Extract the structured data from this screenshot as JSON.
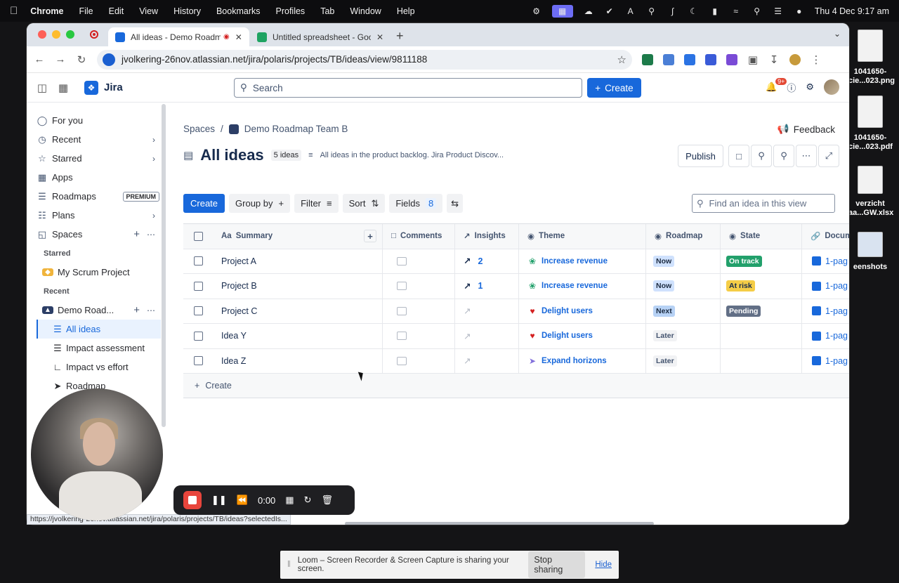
{
  "menubar": {
    "items": [
      "Chrome",
      "File",
      "Edit",
      "View",
      "History",
      "Bookmarks",
      "Profiles",
      "Tab",
      "Window",
      "Help"
    ],
    "datetime": "Thu 4 Dec  9:17 am"
  },
  "desktop": {
    "files": [
      {
        "line1": "1041650-",
        "line2": "cie...023.png"
      },
      {
        "line1": "1041650-",
        "line2": "cie...023.pdf"
      },
      {
        "line1": "verzicht",
        "line2": "aa...GW.xlsx"
      },
      {
        "line1": "",
        "line2": "eenshots"
      }
    ]
  },
  "browser": {
    "tabs": [
      {
        "title": "All ideas - Demo Roadmap",
        "favicon_color": "#1868db"
      },
      {
        "title": "Untitled spreadsheet - Google",
        "favicon_color": "#1ea362"
      }
    ],
    "url": "jvolkering-26nov.atlassian.net/jira/polaris/projects/TB/ideas/view/9811188",
    "status_url": "https://jvolkering-26nov.atlassian.net/jira/polaris/projects/TB/ideas?selectedIs..."
  },
  "jira": {
    "product": "Jira",
    "search_placeholder": "Search",
    "create_label": "Create",
    "notifications_badge": "9+"
  },
  "sidebar": {
    "items": [
      {
        "label": "For you",
        "icon": "person-icon"
      },
      {
        "label": "Recent",
        "icon": "clock-icon"
      },
      {
        "label": "Starred",
        "icon": "star-icon"
      },
      {
        "label": "Apps",
        "icon": "apps-icon"
      },
      {
        "label": "Roadmaps",
        "icon": "roadmaps-icon",
        "badge": "PREMIUM"
      },
      {
        "label": "Plans",
        "icon": "plans-icon"
      },
      {
        "label": "Spaces",
        "icon": "spaces-icon"
      }
    ],
    "starred_heading": "Starred",
    "starred_project": "My Scrum Project",
    "recent_heading": "Recent",
    "recent_project": "Demo Road...",
    "views": [
      {
        "label": "All ideas",
        "selected": true
      },
      {
        "label": "Impact assessment"
      },
      {
        "label": "Impact vs effort"
      },
      {
        "label": "Roadmap"
      }
    ],
    "bottom_partial": "G... e n..."
  },
  "page": {
    "breadcrumb_root": "Spaces",
    "breadcrumb_project": "Demo Roadmap Team B",
    "feedback": "Feedback",
    "title": "All ideas",
    "count": "5 ideas",
    "description": "All ideas in the product backlog. Jira Product Discov...",
    "publish": "Publish",
    "toolbar": {
      "create": "Create",
      "group_by": "Group by",
      "filter": "Filter",
      "sort": "Sort",
      "fields": "Fields",
      "fields_count": "8"
    },
    "find_placeholder": "Find an idea in this view"
  },
  "table": {
    "columns": [
      "Summary",
      "Comments",
      "Insights",
      "Theme",
      "Roadmap",
      "State",
      "Docum"
    ],
    "rows": [
      {
        "summary": "Project A",
        "insights": "2",
        "theme": "Increase revenue",
        "theme_icon": "seedling-icon",
        "roadmap": "Now",
        "state": "On track",
        "doc": "1-pag"
      },
      {
        "summary": "Project B",
        "insights": "1",
        "theme": "Increase revenue",
        "theme_icon": "seedling-icon",
        "roadmap": "Now",
        "state": "At risk",
        "doc": "1-pag"
      },
      {
        "summary": "Project C",
        "insights": "",
        "theme": "Delight users",
        "theme_icon": "heart-icon",
        "roadmap": "Next",
        "state": "Pending",
        "doc": "1-pag"
      },
      {
        "summary": "Idea Y",
        "insights": "",
        "theme": "Delight users",
        "theme_icon": "heart-icon",
        "roadmap": "Later",
        "state": "",
        "doc": "1-pag"
      },
      {
        "summary": "Idea Z",
        "insights": "",
        "theme": "Expand horizons",
        "theme_icon": "rocket-icon",
        "roadmap": "Later",
        "state": "",
        "doc": "1-pag"
      }
    ],
    "create_row": "Create"
  },
  "colors": {
    "accent": "#1868db",
    "now_bg": "#cfe1fd",
    "next_bg": "#b7d2f5",
    "later_bg": "#f1f2f4",
    "on_track": "#22a06b",
    "at_risk": "#f5cd47",
    "pending": "#626f86"
  },
  "loom": {
    "timer": "0:00",
    "share_message": "Loom – Screen Recorder & Screen Capture is sharing your screen.",
    "stop_sharing": "Stop sharing",
    "hide": "Hide"
  }
}
